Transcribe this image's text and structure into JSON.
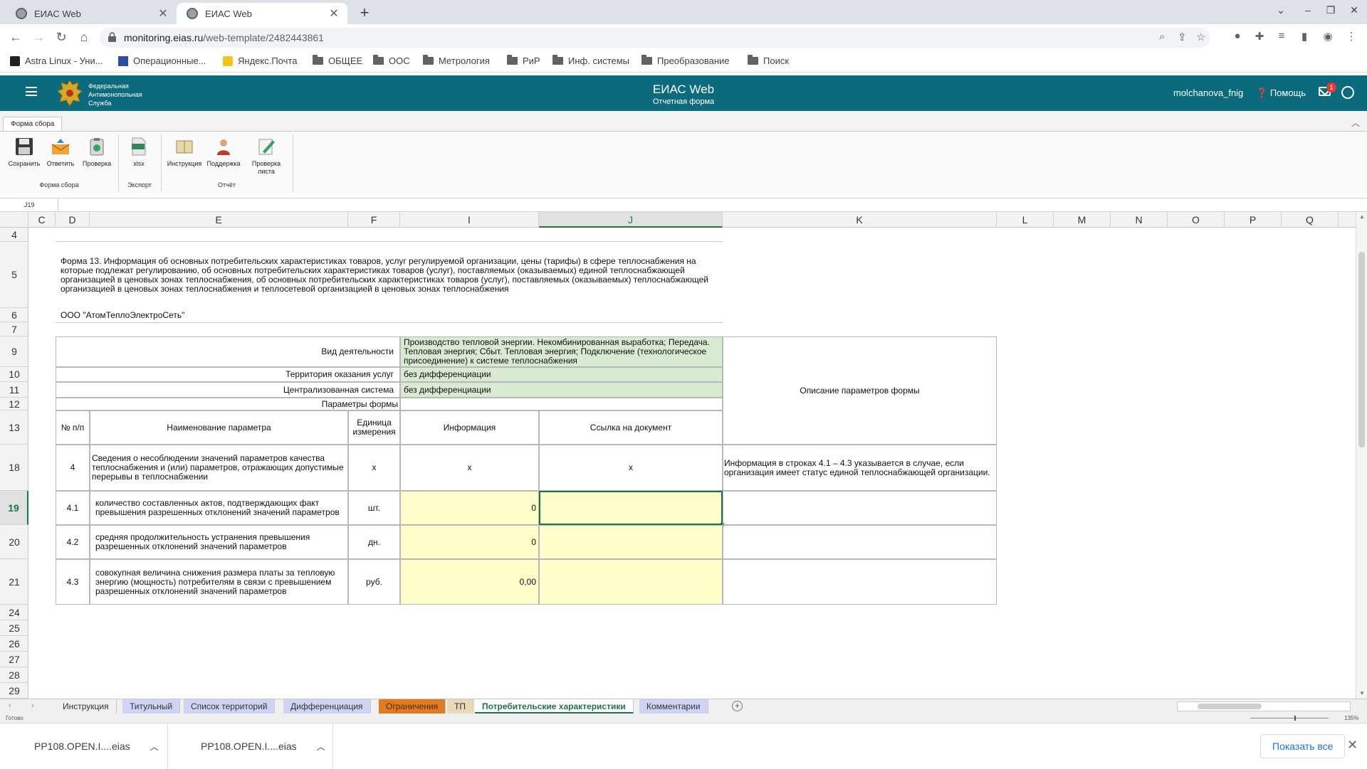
{
  "browser": {
    "tabs": [
      {
        "title": "ЕИАС Web",
        "active": false
      },
      {
        "title": "ЕИАС Web",
        "active": true
      }
    ],
    "url_host": "monitoring.eias.ru",
    "url_path": "/web-template/2482443861",
    "bookmarks": [
      "Astra Linux - Уни...",
      "Операционные...",
      "Яндекс.Почта",
      "ОБЩЕЕ",
      "ООС",
      "Метрология",
      "РиР",
      "Инф. системы",
      "Преобразование",
      "Поиск"
    ]
  },
  "app": {
    "org_line1": "Федеральная",
    "org_line2": "Антимонопольная",
    "org_line3": "Служба",
    "title": "ЕИАС Web",
    "subtitle": "Отчетная форма",
    "user": "molchanova_fnig",
    "help": "Помощь",
    "notifications": "1"
  },
  "ribbon": {
    "tab": "Форма сбора",
    "buttons": {
      "save": "Сохранить",
      "answer": "Ответить",
      "check": "Проверка",
      "xlsx": "xlsx",
      "instruction": "Инструкция",
      "support": "Поддержка",
      "check_sheet": "Проверка листа"
    },
    "groups": {
      "form": "Форма сбора",
      "export": "Экспорт",
      "report": "Отчёт"
    }
  },
  "formula_bar": {
    "name_box": "J19",
    "value": ""
  },
  "columns": [
    "C",
    "D",
    "E",
    "F",
    "I",
    "J",
    "K",
    "L",
    "M",
    "N",
    "O",
    "P",
    "Q"
  ],
  "rows": [
    "4",
    "5",
    "6",
    "7",
    "9",
    "10",
    "11",
    "12",
    "13",
    "18",
    "19",
    "20",
    "21",
    "24",
    "25",
    "26",
    "27",
    "28",
    "29"
  ],
  "sheet": {
    "form_title": "Форма 13. Информация об основных потребительских характеристиках товаров, услуг регулируемой организации, цены (тарифы) в сфере теплоснабжения на которые подлежат регулированию, об основных потребительских характеристиках товаров (услуг), поставляемых (оказываемых) единой теплоснабжающей организацией в ценовых зонах теплоснабжения, об основных потребительских характеристиках товаров (услуг), поставляемых (оказываемых) теплоснабжающей организацией в ценовых зонах теплоснабжения и теплосетевой организацией в ценовых зонах теплоснабжения",
    "organization": "ООО \"АтомТеплоЭлектроСеть\"",
    "activity_label": "Вид деятельности",
    "activity_value": "Производство тепловой энергии. Некомбинированная выработка; Передача. Тепловая энергия; Сбыт. Тепловая энергия; Подключение (технологическое присоединение) к системе теплоснабжения",
    "territory_label": "Территория оказания услуг",
    "territory_value": "без дифференциации",
    "system_label": "Централизованная система",
    "system_value": "без дифференциации",
    "params_label": "Параметры формы",
    "description_header": "Описание параметров формы",
    "headers": {
      "num": "№ п/п",
      "name": "Наименование параметра",
      "unit": "Единица измерения",
      "info": "Информация",
      "doc": "Ссылка на документ"
    },
    "row4": {
      "num": "4",
      "name": "Сведения о несоблюдении значений параметров качества теплоснабжения и (или) параметров, отражающих допустимые перерывы в теплоснабжении",
      "unit": "x",
      "info": "x",
      "doc": "x",
      "desc": "Информация в строках 4.1 – 4.3 указывается в случае, если организация имеет статус единой теплоснабжающей организации."
    },
    "row41": {
      "num": "4.1",
      "name": "количество составленных актов, подтверждающих факт превышения разрешенных отклонений значений параметров",
      "unit": "шт.",
      "info": "0",
      "doc": ""
    },
    "row42": {
      "num": "4.2",
      "name": "средняя продолжительность устранения превышения разрешенных отклонений значений параметров",
      "unit": "дн.",
      "info": "0",
      "doc": ""
    },
    "row43": {
      "num": "4.3",
      "name": "совокупная величина снижения размера платы за тепловую энергию (мощность) потребителям в связи с превышением разрешенных отклонений значений параметров",
      "unit": "руб.",
      "info": "0,00",
      "doc": ""
    }
  },
  "sheet_tabs": [
    {
      "label": "Инструкция",
      "color": "#f0f0f0"
    },
    {
      "label": "Титульный",
      "color": "#cfd3f5"
    },
    {
      "label": "Список территорий",
      "color": "#cfd3f5"
    },
    {
      "label": "Дифференциация",
      "color": "#cfd3f5"
    },
    {
      "label": "Ограничения",
      "color": "#e07b20"
    },
    {
      "label": "ТП",
      "color": "#e8d9b8"
    },
    {
      "label": "Потребительские характеристики",
      "color": "#ffffff",
      "active": true
    },
    {
      "label": "Комментарии",
      "color": "#cfd3f5"
    }
  ],
  "status": {
    "left": "Готово",
    "zoom": "135%"
  },
  "downloads": {
    "items": [
      "PP108.OPEN.I....eias",
      "PP108.OPEN.I....eias"
    ],
    "show_all": "Показать все"
  },
  "colors": {
    "header_teal": "#0b6a7b",
    "input_yellow": "#ffffcc",
    "info_green": "#d9ead3",
    "excel_green": "#217346"
  }
}
